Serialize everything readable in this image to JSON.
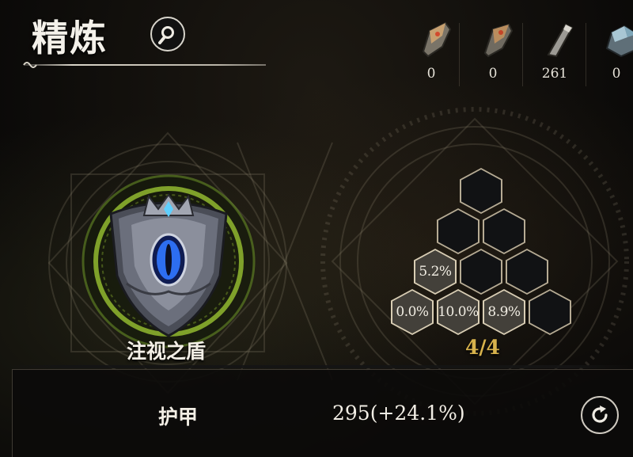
{
  "header": {
    "title": "精炼"
  },
  "resources": [
    {
      "icon": "stone-shard-icon",
      "count": "0"
    },
    {
      "icon": "stone-shard-icon",
      "count": "0"
    },
    {
      "icon": "metal-shard-icon",
      "count": "261"
    },
    {
      "icon": "crystal-ore-icon",
      "count": "0"
    }
  ],
  "item": {
    "name": "注视之盾",
    "icon": "eye-shield-icon"
  },
  "refine_slots": {
    "counter": "4/4",
    "filled_bonuses": [
      "5.2%",
      "0.0%",
      "10.0%",
      "8.9%"
    ]
  },
  "stat": {
    "label": "护甲",
    "value": "295(+24.1%)"
  },
  "colors": {
    "accent_gold": "#d7b24c",
    "frame_green": "#7fa12a",
    "eye_blue": "#2d6ef0"
  }
}
